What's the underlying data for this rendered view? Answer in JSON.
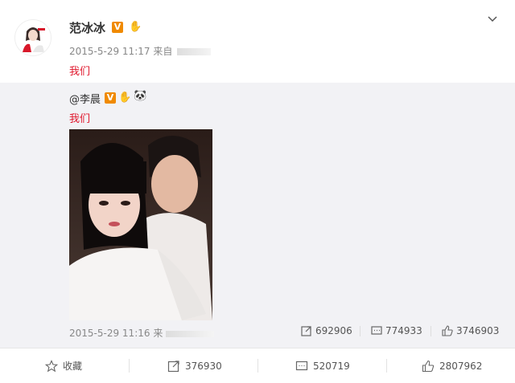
{
  "post": {
    "username": "范冰冰",
    "verified_badge": "V",
    "timestamp": "2015-5-29 11:17 来自",
    "text": "我们"
  },
  "repost": {
    "author": "@李晨",
    "verified_badge": "V",
    "text": "我们",
    "timestamp": "2015-5-29 11:16 来",
    "stats": {
      "reposts": "692906",
      "comments": "774933",
      "likes": "3746903"
    }
  },
  "actions": {
    "favorite": "收藏",
    "repost": "376930",
    "comment": "520719",
    "like": "2807962"
  },
  "colors": {
    "link_red": "#e0182d",
    "badge_orange": "#f08a00",
    "repost_bg": "#f2f2f5"
  },
  "icons": [
    "chevron-down-icon",
    "verified-v-icon",
    "fan-hand-icon",
    "panda-icon",
    "repost-icon",
    "comment-icon",
    "like-icon",
    "star-icon"
  ]
}
